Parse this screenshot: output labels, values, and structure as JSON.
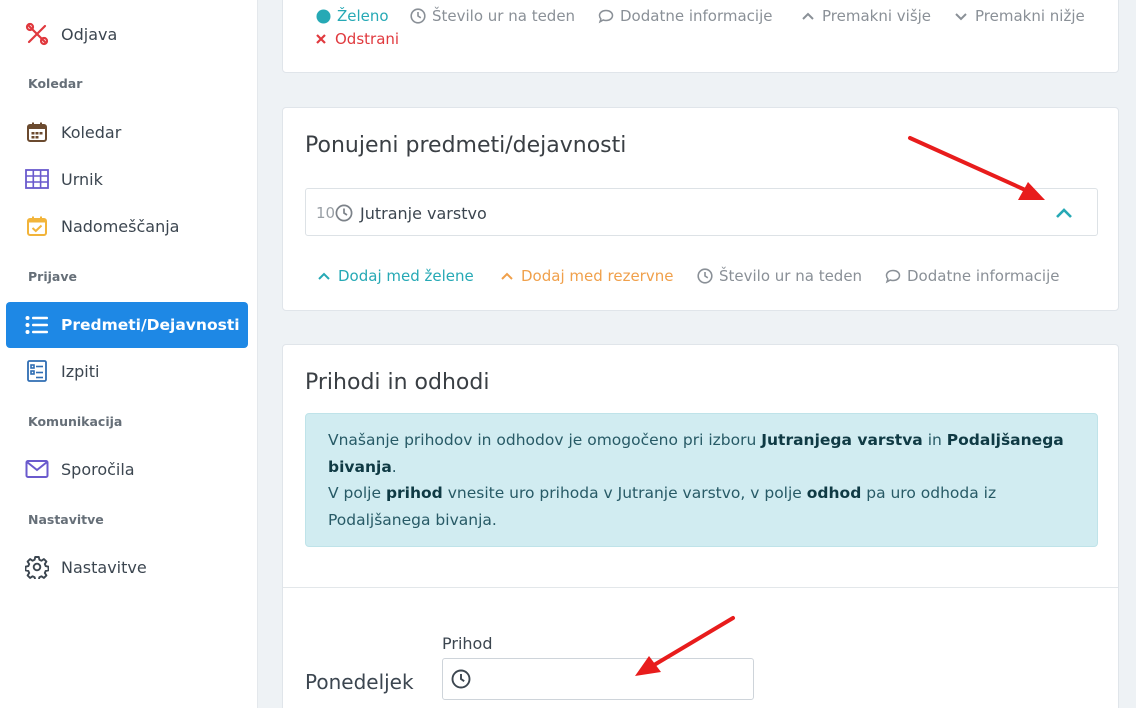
{
  "sidebar": {
    "items": [
      {
        "label": "Odjava",
        "icon": "logout-icon"
      },
      {
        "label": "Koledar",
        "icon": "calendar-icon"
      },
      {
        "label": "Urnik",
        "icon": "grid-icon"
      },
      {
        "label": "Nadomeščanja",
        "icon": "calendar-check-icon"
      },
      {
        "label": "Predmeti/Dejavnosti",
        "icon": "list-icon"
      },
      {
        "label": "Izpiti",
        "icon": "checklist-icon"
      },
      {
        "label": "Sporočila",
        "icon": "envelope-icon"
      },
      {
        "label": "Nastavitve",
        "icon": "gear-icon"
      }
    ],
    "sections": [
      "Koledar",
      "Prijave",
      "Komunikacija",
      "Nastavitve"
    ]
  },
  "top_card": {
    "actions": {
      "zeleno": "Želeno",
      "hours": "Število ur na teden",
      "info": "Dodatne informacije",
      "move_up": "Premakni višje",
      "move_down": "Premakni nižje",
      "remove": "Odstrani"
    }
  },
  "offered": {
    "title": "Ponujeni predmeti/dejavnosti",
    "subject": {
      "hours": "10",
      "name": "Jutranje varstvo"
    },
    "actions": {
      "add_green": "Dodaj med želene",
      "add_reserve": "Dodaj med rezervne",
      "hours": "Število ur na teden",
      "info": "Dodatne informacije"
    }
  },
  "arrivals": {
    "title": "Prihodi in odhodi",
    "info": {
      "t1": "Vnašanje prihodov in odhodov je omogočeno pri izboru ",
      "b1": "Jutranjega varstva",
      "t2": " in ",
      "b2": "Podaljšanega bivanja",
      "t3": ".",
      "t4": "V polje ",
      "b3": "prihod",
      "t5": " vnesite uro prihoda v Jutranje varstvo, v polje ",
      "b4": "odhod",
      "t6": " pa uro odhoda iz Podaljšanega bivanja."
    },
    "day": "Ponedeljek",
    "field_label": "Prihod"
  },
  "colors": {
    "accent": "#1e88e5",
    "teal": "#26a9b5",
    "orange": "#f0a04b",
    "red": "#e0393e",
    "annotation_arrow": "#e81c1c"
  }
}
